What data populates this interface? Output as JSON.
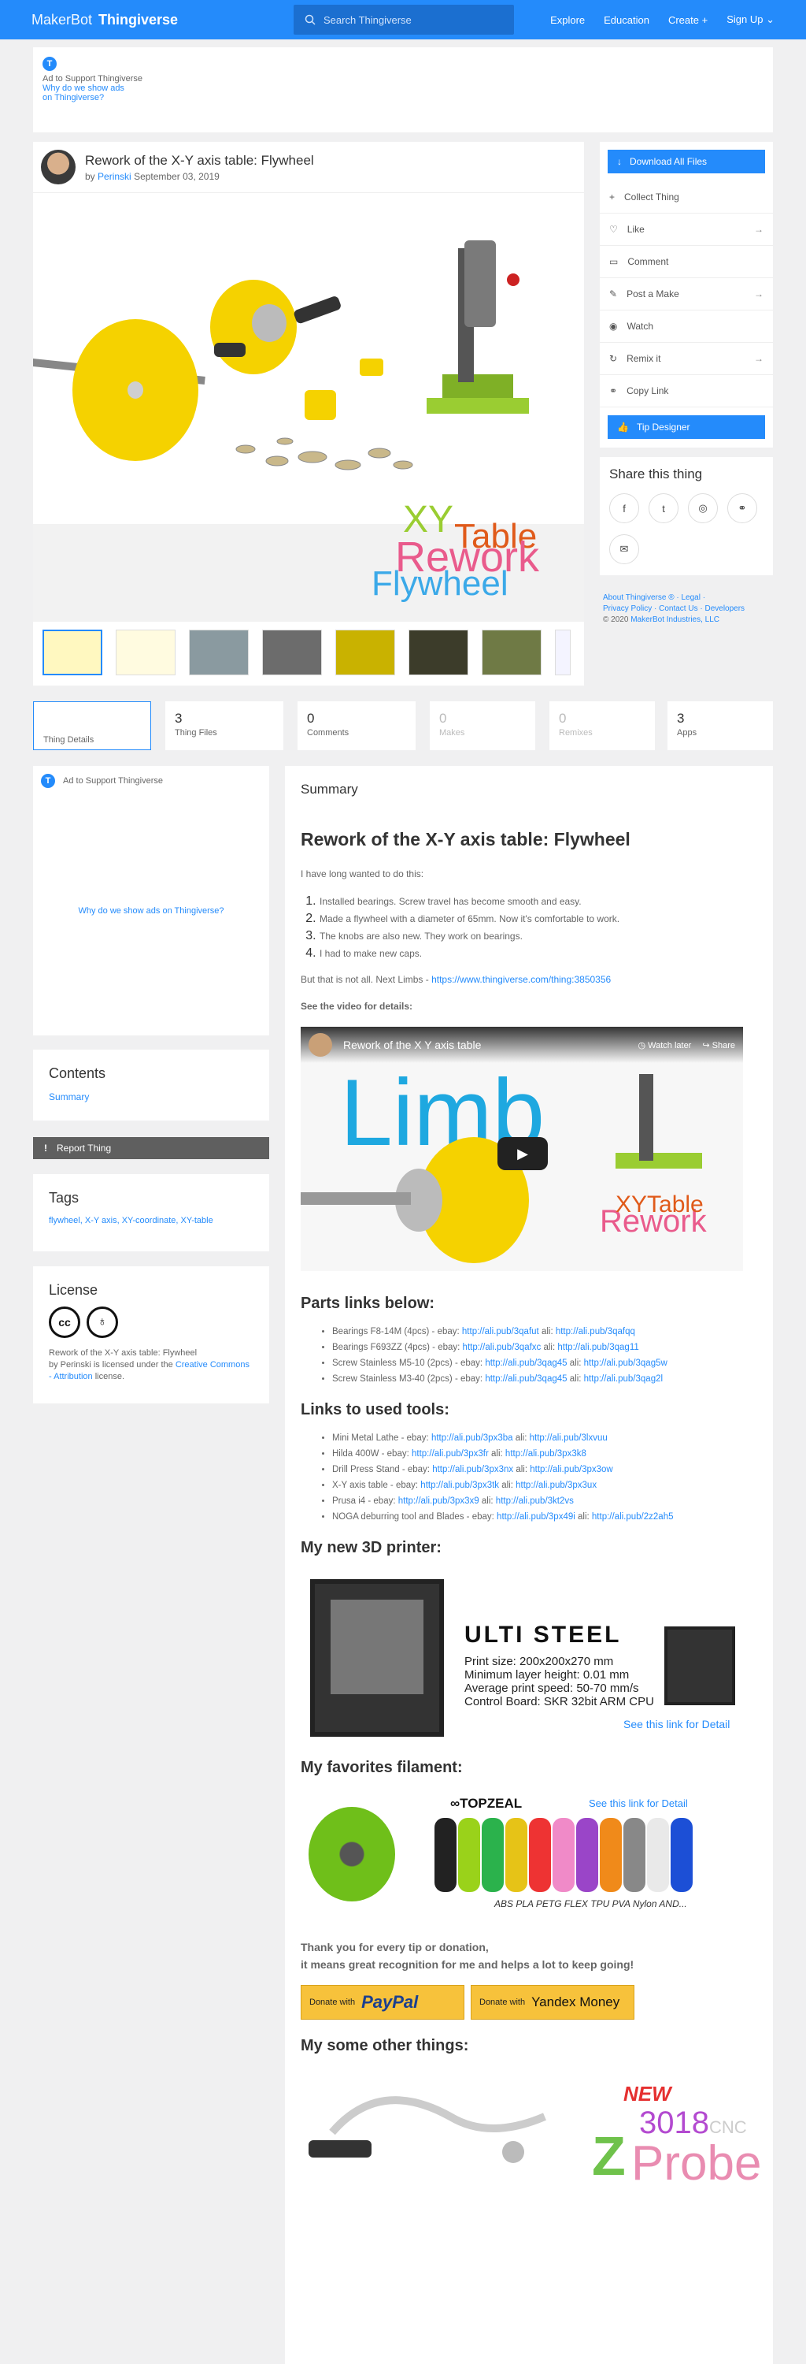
{
  "header": {
    "brand_a": "MakerBot",
    "brand_b": "Thingiverse",
    "search_placeholder": "Search Thingiverse",
    "nav": [
      "Explore",
      "Education",
      "Create",
      "Sign Up"
    ]
  },
  "top_ad": {
    "label": "Ad to Support Thingiverse",
    "why_line1": "Why do we show ads",
    "why_line2": "on Thingiverse?"
  },
  "thing": {
    "title": "Rework of the X-Y axis table: Flywheel",
    "by": "by",
    "author": "Perinski",
    "date": "September 03, 2019",
    "hero_text": [
      "XY",
      "Table",
      "Rework",
      "Flywheel"
    ]
  },
  "actions": {
    "download": "Download All Files",
    "items": [
      "Collect Thing",
      "Like",
      "Comment",
      "Post a Make",
      "Watch",
      "Remix it",
      "Copy Link"
    ],
    "tip": "Tip Designer"
  },
  "share": {
    "title": "Share this thing"
  },
  "footer": {
    "line1": "About Thingiverse ® · Legal ·",
    "line2": "Privacy Policy · Contact Us · Developers",
    "copyright": "© 2020",
    "company": "MakerBot Industries, LLC"
  },
  "stats": [
    {
      "n": "",
      "label": "Thing Details"
    },
    {
      "n": "3",
      "label": "Thing Files"
    },
    {
      "n": "0",
      "label": "Comments"
    },
    {
      "n": "0",
      "label": "Makes"
    },
    {
      "n": "0",
      "label": "Remixes"
    },
    {
      "n": "3",
      "label": "Apps"
    }
  ],
  "sidebar": {
    "ad_label": "Ad to Support Thingiverse",
    "ad_why": "Why do we show ads on Thingiverse?",
    "contents_title": "Contents",
    "contents_item": "Summary",
    "report": "Report Thing",
    "tags_title": "Tags",
    "tags": "flywheel, X-Y axis, XY-coordinate, XY-table",
    "license_title": "License",
    "license_text1": "Rework of the X-Y axis table: Flywheel",
    "license_text2": "by Perinski is licensed under the",
    "license_link": "Creative Commons - Attribution",
    "license_text3": "license."
  },
  "main": {
    "summary_label": "Summary",
    "heading": "Rework of the X-Y axis table: Flywheel",
    "intro": "I have long wanted to do this:",
    "list": [
      "Installed bearings. Screw travel has become smooth and easy.",
      "Made a flywheel with a diameter of 65mm. Now it's comfortable to work.",
      "The knobs are also new. They work on bearings.",
      "I had to make new caps."
    ],
    "limbs_text": "But that is not all. Next Limbs -",
    "limbs_link": "https://www.thingiverse.com/thing:3850356",
    "video_label": "See the video for details:",
    "video_title": "Rework of the X Y axis table",
    "video_watch": "Watch later",
    "video_share": "Share",
    "video_big": "Limb",
    "parts_title": "Parts links below:",
    "parts": [
      {
        "t": "Bearings F8-14M (4pcs) - ebay:",
        "a": "http://ali.pub/3qafut",
        "m": "ali:",
        "b": "http://ali.pub/3qafqq"
      },
      {
        "t": "Bearings F693ZZ (4pcs) - ebay:",
        "a": "http://ali.pub/3qafxc",
        "m": "ali:",
        "b": "http://ali.pub/3qag11"
      },
      {
        "t": "Screw Stainless M5-10 (2pcs) - ebay:",
        "a": "http://ali.pub/3qag45",
        "m": "ali:",
        "b": "http://ali.pub/3qag5w"
      },
      {
        "t": "Screw Stainless M3-40 (2pcs) - ebay:",
        "a": "http://ali.pub/3qag45",
        "m": "ali:",
        "b": "http://ali.pub/3qag2l"
      }
    ],
    "tools_title": "Links to used tools:",
    "tools": [
      {
        "t": "Mini Metal Lathe - ebay:",
        "a": "http://ali.pub/3px3ba",
        "m": "ali:",
        "b": "http://ali.pub/3lxvuu"
      },
      {
        "t": "Hilda 400W - ebay:",
        "a": "http://ali.pub/3px3fr",
        "m": "ali:",
        "b": "http://ali.pub/3px3k8"
      },
      {
        "t": "Drill Press Stand - ebay:",
        "a": "http://ali.pub/3px3nx",
        "m": "ali:",
        "b": "http://ali.pub/3px3ow"
      },
      {
        "t": "X-Y axis table - ebay:",
        "a": "http://ali.pub/3px3tk",
        "m": "ali:",
        "b": "http://ali.pub/3px3ux"
      },
      {
        "t": "Prusa i4 - ebay:",
        "a": "http://ali.pub/3px3x9",
        "m": "ali:",
        "b": "http://ali.pub/3kt2vs"
      },
      {
        "t": "NOGA deburring tool and Blades - ebay:",
        "a": "http://ali.pub/3px49i",
        "m": "ali:",
        "b": "http://ali.pub/2z2ah5"
      }
    ],
    "printer_title": "My new 3D printer:",
    "printer_name": "ULTI STEEL",
    "printer_specs": [
      "Print size: 200x200x270 mm",
      "Minimum layer height: 0.01 mm",
      "Average print speed: 50-70 mm/s",
      "Control Board: SKR 32bit ARM CPU"
    ],
    "printer_link": "See this link for Detail",
    "filament_title": "My favorites filament:",
    "filament_brand": "TOPZEAL",
    "filament_link": "See this link for Detail",
    "filament_types": "ABS PLA PETG FLEX TPU PVA Nylon AND...",
    "thanks1": "Thank you for every tip or donation,",
    "thanks2": "it means great recognition for me and helps a lot to keep going!",
    "donate_paypal_pre": "Donate with",
    "donate_paypal": "PayPal",
    "donate_yandex_pre": "Donate with",
    "donate_yandex": "Yandex Money",
    "other_title": "My some other things:",
    "other_new": "NEW",
    "other_num": "3018",
    "other_cnc": "CNC",
    "other_probe": "Probe"
  }
}
